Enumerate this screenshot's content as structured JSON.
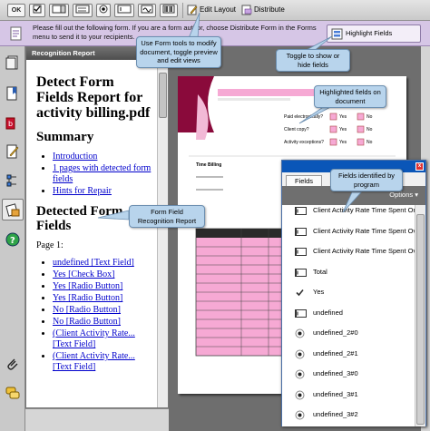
{
  "toolbar": {
    "ok_label": "OK",
    "edit_layout_label": "Edit Layout",
    "distribute_label": "Distribute"
  },
  "message_bar": {
    "text": "Please fill out the following form. If you are a form author, choose Distribute Form in the Forms menu to send it to your recipients.",
    "highlight_label": "Highlight Fields"
  },
  "report_panel": {
    "title": "Recognition Report",
    "heading": "Detect Form Fields Report for activity billing.pdf",
    "summary_heading": "Summary",
    "summary_links": [
      "Introduction",
      "1 pages with detected form fields",
      "Hints for Repair"
    ],
    "detected_heading": "Detected Form Fields",
    "page_label": "Page 1:",
    "detected_items": [
      {
        "name": "undefined",
        "type": "[Text Field]"
      },
      {
        "name": "Yes",
        "type": "[Check Box]"
      },
      {
        "name": "Yes",
        "type": "[Radio Button]"
      },
      {
        "name": "Yes",
        "type": "[Radio Button]"
      },
      {
        "name": "No",
        "type": "[Radio Button]"
      },
      {
        "name": "No",
        "type": "[Radio Button]"
      },
      {
        "name": "(Client Activity Rate...",
        "type": "[Text Field]"
      },
      {
        "name": "(Client Activity Rate...",
        "type": "[Text Field]"
      }
    ]
  },
  "document": {
    "labels": [
      "Paid electronically?",
      "Client copy?",
      "Activity exceptions?"
    ],
    "yes_label": "Yes",
    "no_label": "No",
    "section_label": "Time Billing"
  },
  "fields_panel": {
    "tab_label": "Fields",
    "options_label": "Options",
    "rows": [
      {
        "label": "Client Activity Rate Time Spent On",
        "icon": "text-field-icon"
      },
      {
        "label": "Client Activity Rate Time Spent Ov",
        "icon": "text-field-icon"
      },
      {
        "label": "Client Activity Rate Time Spent Ov",
        "icon": "text-field-icon"
      },
      {
        "label": "Total",
        "icon": "text-field-icon"
      },
      {
        "label": "Yes",
        "icon": "checkbox-icon"
      },
      {
        "label": "undefined",
        "icon": "text-field-icon"
      },
      {
        "label": "undefined_2#0",
        "icon": "radio-icon"
      },
      {
        "label": "undefined_2#1",
        "icon": "radio-icon"
      },
      {
        "label": "undefined_3#0",
        "icon": "radio-icon"
      },
      {
        "label": "undefined_3#1",
        "icon": "radio-icon"
      },
      {
        "label": "undefined_3#2",
        "icon": "radio-icon"
      }
    ]
  },
  "callouts": {
    "form_tools": "Use Form tools to modify document, toggle preview and edit views",
    "toggle": "Toggle to show or hide fields",
    "highlighted": "Highlighted fields on document",
    "identified": "Fields identified by program",
    "report": "Form Field Recognition Report"
  },
  "colors": {
    "message_bar": "#d6c6e6",
    "callout": "#b8d4ec",
    "field_highlight": "#f6a9d4",
    "title_bar": "#0a56b8",
    "link": "#0000cc"
  }
}
